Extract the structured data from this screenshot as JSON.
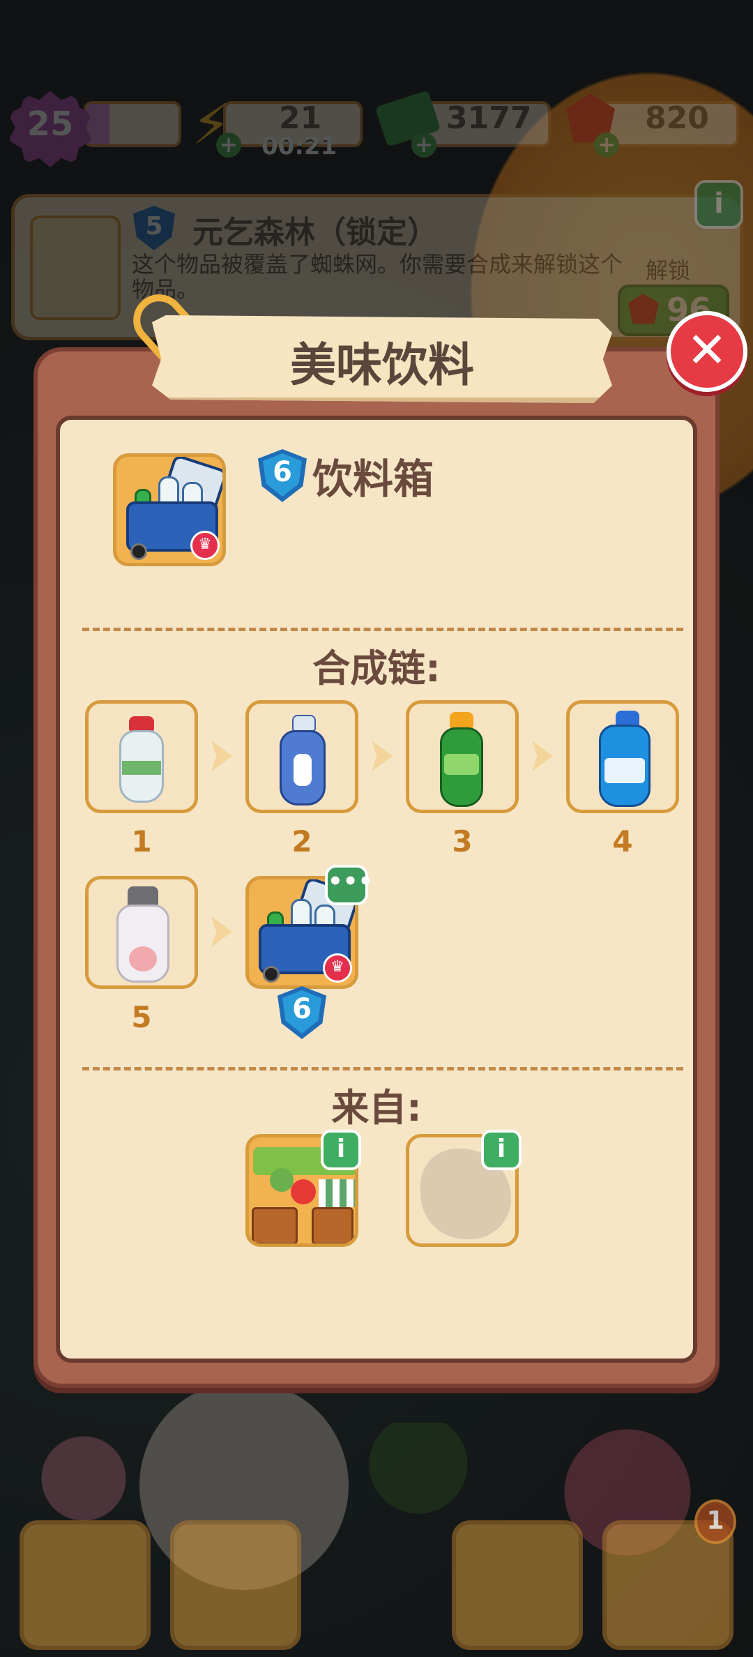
{
  "hud": {
    "level": "25",
    "level_progress": 0.25,
    "energy": "21",
    "energy_timer": "00:21",
    "cash": "3177",
    "gems": "820"
  },
  "info_strip": {
    "level": "5",
    "title": "元乞森林（锁定）",
    "description": "这个物品被覆盖了蜘蛛网。你需要合成来解锁这个物品。",
    "unlock_label": "解锁",
    "unlock_cost": "96"
  },
  "modal": {
    "title": "美味饮料",
    "item": {
      "level": "6",
      "name": "饮料箱"
    },
    "merge_chain_title": "合成链:",
    "merge_chain": [
      {
        "step": "1",
        "icon": "water-bottle-red-cap-icon"
      },
      {
        "step": "2",
        "icon": "blue-bottle-icon"
      },
      {
        "step": "3",
        "icon": "green-soda-bottle-icon"
      },
      {
        "step": "4",
        "icon": "sports-drink-bottle-icon"
      },
      {
        "step": "5",
        "icon": "yuanqi-bottle-icon"
      },
      {
        "step": "6",
        "icon": "drink-cooler-icon"
      }
    ],
    "source_title": "来自:",
    "sources": [
      {
        "icon": "market-stall-icon"
      },
      {
        "icon": "unknown-source-icon"
      }
    ]
  },
  "bottom_bar": {
    "badge_count": "1"
  },
  "colors": {
    "modal_bg": "#a8644f",
    "panel_bg": "#f6e6c6",
    "tile_border": "#d79b3d",
    "close_red": "#e63a45",
    "shield_blue": "#1f6db7",
    "text_brown": "#6b4a3e",
    "step_orange": "#c27a23"
  }
}
